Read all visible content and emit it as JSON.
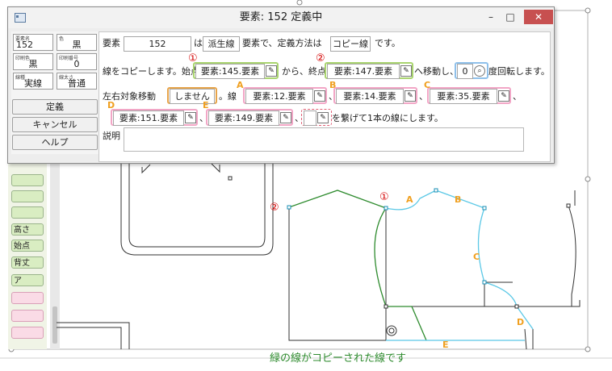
{
  "window": {
    "title": "要素: 152 定義中"
  },
  "window_controls": {
    "minimize": "–",
    "maximize": "□",
    "close": "✕"
  },
  "attributes": [
    {
      "label": "要素名",
      "value": "152"
    },
    {
      "label": "色",
      "value": "黒"
    },
    {
      "label": "印刷色",
      "value": "黒"
    },
    {
      "label": "印刷番号",
      "value": "0"
    },
    {
      "label": "線種",
      "value": "実線"
    },
    {
      "label": "線太さ",
      "value": "普通"
    }
  ],
  "buttons": {
    "define": "定義",
    "cancel": "キャンセル",
    "help": "ヘルプ"
  },
  "row1": {
    "t1": "要素",
    "element": "152",
    "t2": "は",
    "kind": "派生線",
    "t3": "要素で、定義方法は",
    "method": "コピー線",
    "t4": "です。"
  },
  "row2": {
    "t1": "線をコピーします。始点",
    "start": "要素:145.要素",
    "t2": "から、終点",
    "end": "要素:147.要素",
    "t3": "へ移動し、",
    "rotation": "0",
    "t4": "度回転します。"
  },
  "row3": {
    "t1": "左右対象移動",
    "mirror": "しません",
    "t2": "。線",
    "lineA": "要素:12.要素",
    "lineB": "要素:14.要素",
    "lineC": "要素:35.要素",
    "sep": "、"
  },
  "row4": {
    "lineD": "要素:151.要素",
    "lineE": "要素:149.要素",
    "empty": "",
    "t1": "を繋げて1本の線にします。",
    "sep": "、"
  },
  "desc_label": "説明",
  "description": "",
  "annotations": {
    "one": "①",
    "two": "②",
    "A": "A",
    "B": "B",
    "C": "C",
    "D": "D",
    "E": "E"
  },
  "palette": [
    "高さ",
    "始点",
    "背丈",
    "ア"
  ],
  "caption": "緑の線がコピーされた線です",
  "colors": {
    "green_line": "#2e8b2e",
    "cyan_line": "#5bc8e6",
    "annotation_red": "#d40000",
    "annotation_orange": "#f0a020"
  }
}
